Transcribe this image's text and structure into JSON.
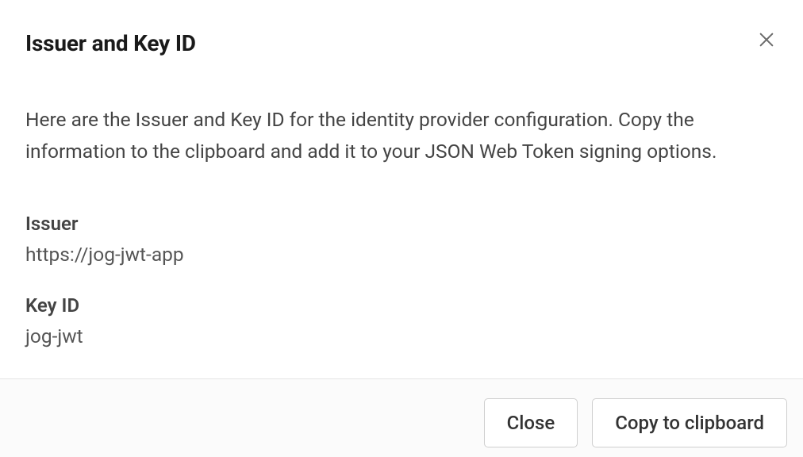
{
  "dialog": {
    "title": "Issuer and Key ID",
    "description": "Here are the Issuer and Key ID for the identity provider configuration. Copy the information to the clipboard and add it to your JSON Web Token signing options.",
    "fields": {
      "issuer": {
        "label": "Issuer",
        "value": "https://jog-jwt-app"
      },
      "keyId": {
        "label": "Key ID",
        "value": "jog-jwt"
      }
    },
    "buttons": {
      "close": "Close",
      "copy": "Copy to clipboard"
    }
  }
}
